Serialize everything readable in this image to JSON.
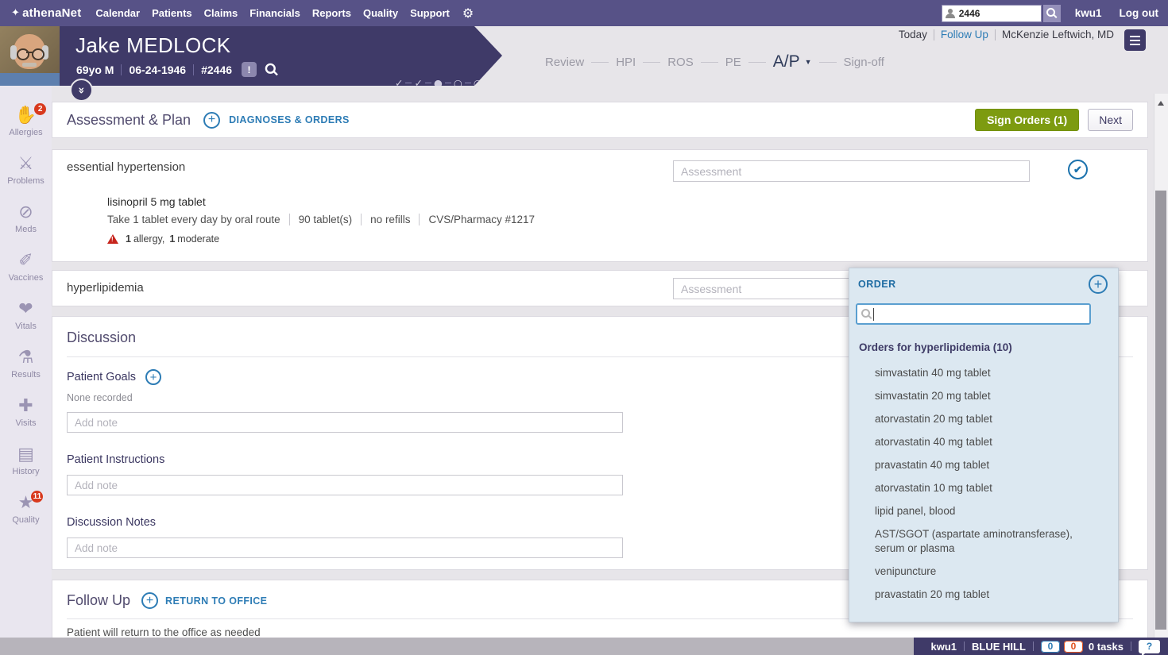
{
  "icons": {
    "brand_glyph": "✦",
    "gear_glyph": "⚙",
    "plus_glyph": "+",
    "check_glyph": "✔",
    "bang_glyph": "!",
    "double_chevron_glyph": "«",
    "help_glyph": "?"
  },
  "top_nav": {
    "brand": "athenaNet",
    "menu": [
      "Calendar",
      "Patients",
      "Claims",
      "Financials",
      "Reports",
      "Quality",
      "Support"
    ],
    "search_value": "2446",
    "username": "kwu1",
    "logout_label": "Log out"
  },
  "patient_banner": {
    "name": "Jake MEDLOCK",
    "age_sex": "69yo M",
    "dob": "06-24-1946",
    "patient_id": "#2446",
    "progress_glyphs": [
      "✓",
      "✓",
      "●",
      "○",
      "○"
    ]
  },
  "encounter_header": {
    "today_label": "Today",
    "follow_up_label": "Follow Up",
    "provider": "McKenzie Leftwich, MD"
  },
  "workflow": {
    "steps": [
      {
        "label": "Review"
      },
      {
        "label": "HPI"
      },
      {
        "label": "ROS"
      },
      {
        "label": "PE"
      },
      {
        "label": "A/P",
        "active": true,
        "caret": "▼"
      },
      {
        "label": "Sign-off"
      }
    ]
  },
  "sidebar": {
    "items": [
      {
        "label": "Allergies",
        "icon": "allergies-hand-icon",
        "glyph": "✋",
        "badge": "2"
      },
      {
        "label": "Problems",
        "icon": "crossed-bandages-icon",
        "glyph": "⚔"
      },
      {
        "label": "Meds",
        "icon": "pills-icon",
        "glyph": "⊘"
      },
      {
        "label": "Vaccines",
        "icon": "syringe-icon",
        "glyph": "✐"
      },
      {
        "label": "Vitals",
        "icon": "heart-pulse-icon",
        "glyph": "❤"
      },
      {
        "label": "Results",
        "icon": "lab-flask-icon",
        "glyph": "⚗"
      },
      {
        "label": "Visits",
        "icon": "medical-bag-icon",
        "glyph": "✚"
      },
      {
        "label": "History",
        "icon": "clipboard-icon",
        "glyph": "▤"
      },
      {
        "label": "Quality",
        "icon": "star-icon",
        "glyph": "★",
        "badge": "11"
      }
    ]
  },
  "ap_header": {
    "title": "Assessment & Plan",
    "add_link": "DIAGNOSES & ORDERS",
    "sign_orders_label": "Sign Orders (1)",
    "next_label": "Next"
  },
  "diagnoses": {
    "hypertension": {
      "name": "essential hypertension",
      "assessment_placeholder": "Assessment",
      "med_name": "lisinopril 5 mg tablet",
      "sig_parts": [
        "Take 1 tablet every day by oral route",
        "90 tablet(s)",
        "no refills",
        "CVS/Pharmacy #1217"
      ],
      "warning": {
        "count1": "1",
        "label1": "allergy,",
        "count2": "1",
        "label2": "moderate"
      }
    },
    "hyperlipidemia": {
      "name": "hyperlipidemia",
      "assessment_placeholder": "Assessment"
    }
  },
  "order_popup": {
    "title": "ORDER",
    "group_label": "Orders for hyperlipidemia (10)",
    "items": [
      "simvastatin 40 mg tablet",
      "simvastatin 20 mg tablet",
      "atorvastatin 20 mg tablet",
      "atorvastatin 40 mg tablet",
      "pravastatin 40 mg tablet",
      "atorvastatin 10 mg tablet",
      "lipid panel, blood",
      "AST/SGOT (aspartate aminotransferase), serum or plasma",
      "venipuncture",
      "pravastatin 20 mg tablet"
    ]
  },
  "discussion": {
    "title": "Discussion",
    "patient_goals_label": "Patient Goals",
    "patient_goals_value": "None recorded",
    "patient_instructions_label": "Patient Instructions",
    "discussion_notes_label": "Discussion Notes",
    "note_placeholder": "Add note"
  },
  "follow_up": {
    "title": "Follow Up",
    "add_link": "RETURN TO OFFICE",
    "note": "Patient will return to the office as needed"
  },
  "status_bar": {
    "username": "kwu1",
    "department": "BLUE HILL",
    "count_blue": "0",
    "count_orange": "0",
    "tasks_label": "0 tasks"
  },
  "colors": {
    "nav_purple": "#575287",
    "banner_purple": "#3f3a68",
    "accent_blue": "#2d7cb5",
    "sign_green": "#7d9b10",
    "alert_red": "#c7251d",
    "badge_red": "#d8391d",
    "popup_bg": "#dce8f1",
    "page_bg": "#e7e5e9"
  }
}
